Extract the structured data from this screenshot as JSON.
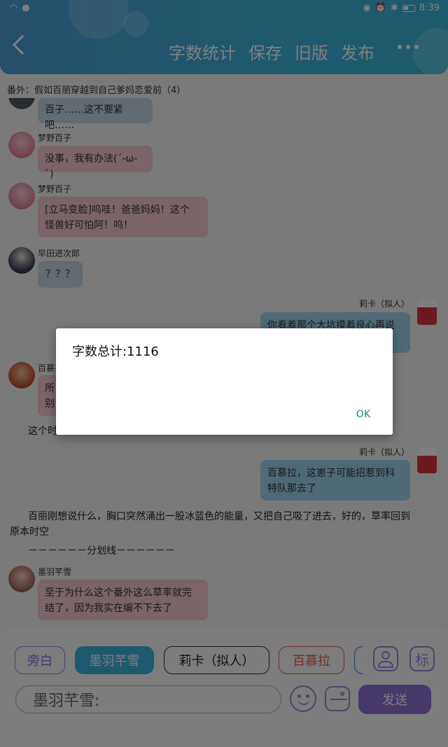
{
  "status_bar": {
    "time": "8:39"
  },
  "header": {
    "menu": [
      "字数统计",
      "保存",
      "旧版",
      "发布"
    ]
  },
  "subtitle": "番外：假如百丽穿越到自己爹妈恋爱前（4）",
  "messages": [
    {
      "name": "",
      "text": "百子……这不要紧吧……"
    },
    {
      "name": "梦野百子",
      "text": "没事，我有办法(´-ω-`)"
    },
    {
      "name": "梦野百子",
      "text1": "[立马变脸]呜哇！爸爸妈妈！这个",
      "text2": "怪兽好可怕阿！呜！"
    },
    {
      "name": "早田进次郎",
      "text": "？？？"
    },
    {
      "name": "莉卡（拟人）",
      "text": "你看着那个大坑摸着良心再说"
    },
    {
      "name": "百慕拉",
      "text1": "所",
      "text2": "别"
    },
    {
      "narration": "这个时"
    },
    {
      "name": "莉卡（拟人）",
      "text1": "百慕拉，这崽子可能招惹到科",
      "text2": "特队那去了"
    },
    {
      "narration1": "百丽刚想说什么，胸口突然涌出一股冰蓝色的能量，又把自己吸了进去，好的，草率回到",
      "narration2": "原本时空"
    },
    {
      "divider": "－－－－－－分划线－－－－－－"
    },
    {
      "name": "墨羽芊雪",
      "text1": "至于为什么这个番外这么草率就完",
      "text2": "结了，因为我实在编不下去了"
    }
  ],
  "chips": [
    "旁白",
    "墨羽芊雪",
    "莉卡（拟人）",
    "百慕拉"
  ],
  "input": {
    "value": "墨羽芊雪:"
  },
  "send_label": "发送",
  "tool_label_tag": "标",
  "dialog": {
    "title": "字数总计:1116",
    "ok": "OK"
  },
  "colors": {
    "accent": "#3fb3dc",
    "purple": "#8e70d6"
  }
}
